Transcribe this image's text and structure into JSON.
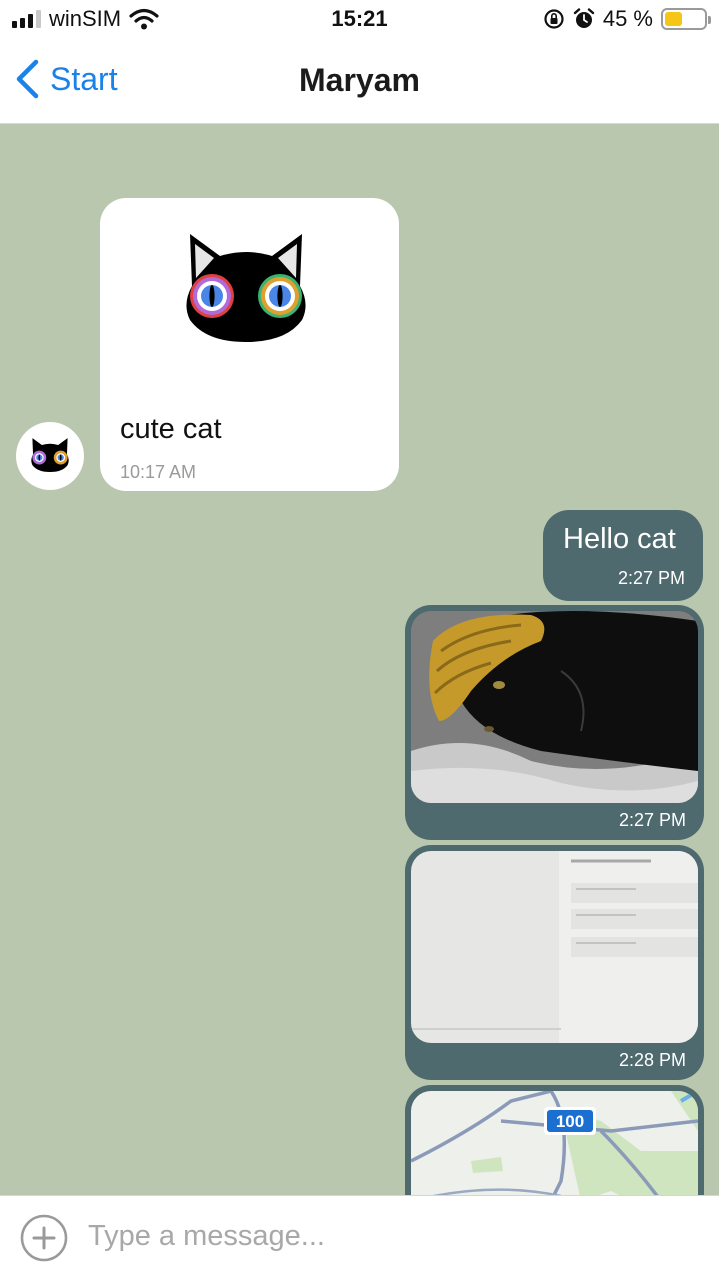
{
  "status_bar": {
    "carrier": "winSIM",
    "time": "15:21",
    "battery_percent_label": "45 %",
    "battery_level": 0.45,
    "battery_color": "#f5c518",
    "icons": [
      "signal-icon",
      "wifi-icon",
      "rotation-lock-icon",
      "alarm-icon",
      "battery-icon"
    ]
  },
  "nav": {
    "back_label": "Start",
    "title": "Maryam",
    "accent_color": "#1a82e8"
  },
  "messages": [
    {
      "direction": "incoming",
      "type": "sticker",
      "sticker": "black-cat-face",
      "text": "cute cat",
      "time": "10:17 AM"
    },
    {
      "direction": "outgoing",
      "type": "text",
      "text": "Hello cat",
      "time": "2:27 PM"
    },
    {
      "direction": "outgoing",
      "type": "photo",
      "photo": "black cat in yellow knit hat",
      "time": "2:27 PM"
    },
    {
      "direction": "outgoing",
      "type": "photo",
      "photo": "screen photo",
      "time": "2:28 PM"
    },
    {
      "direction": "outgoing",
      "type": "photo",
      "photo": "map",
      "time": "",
      "map_route_badge": "100"
    }
  ],
  "composer": {
    "placeholder": "Type a message...",
    "value": ""
  },
  "colors": {
    "chat_background": "#b9c7ae",
    "outgoing_bubble": "#4e6a6f",
    "incoming_bubble": "#ffffff"
  }
}
